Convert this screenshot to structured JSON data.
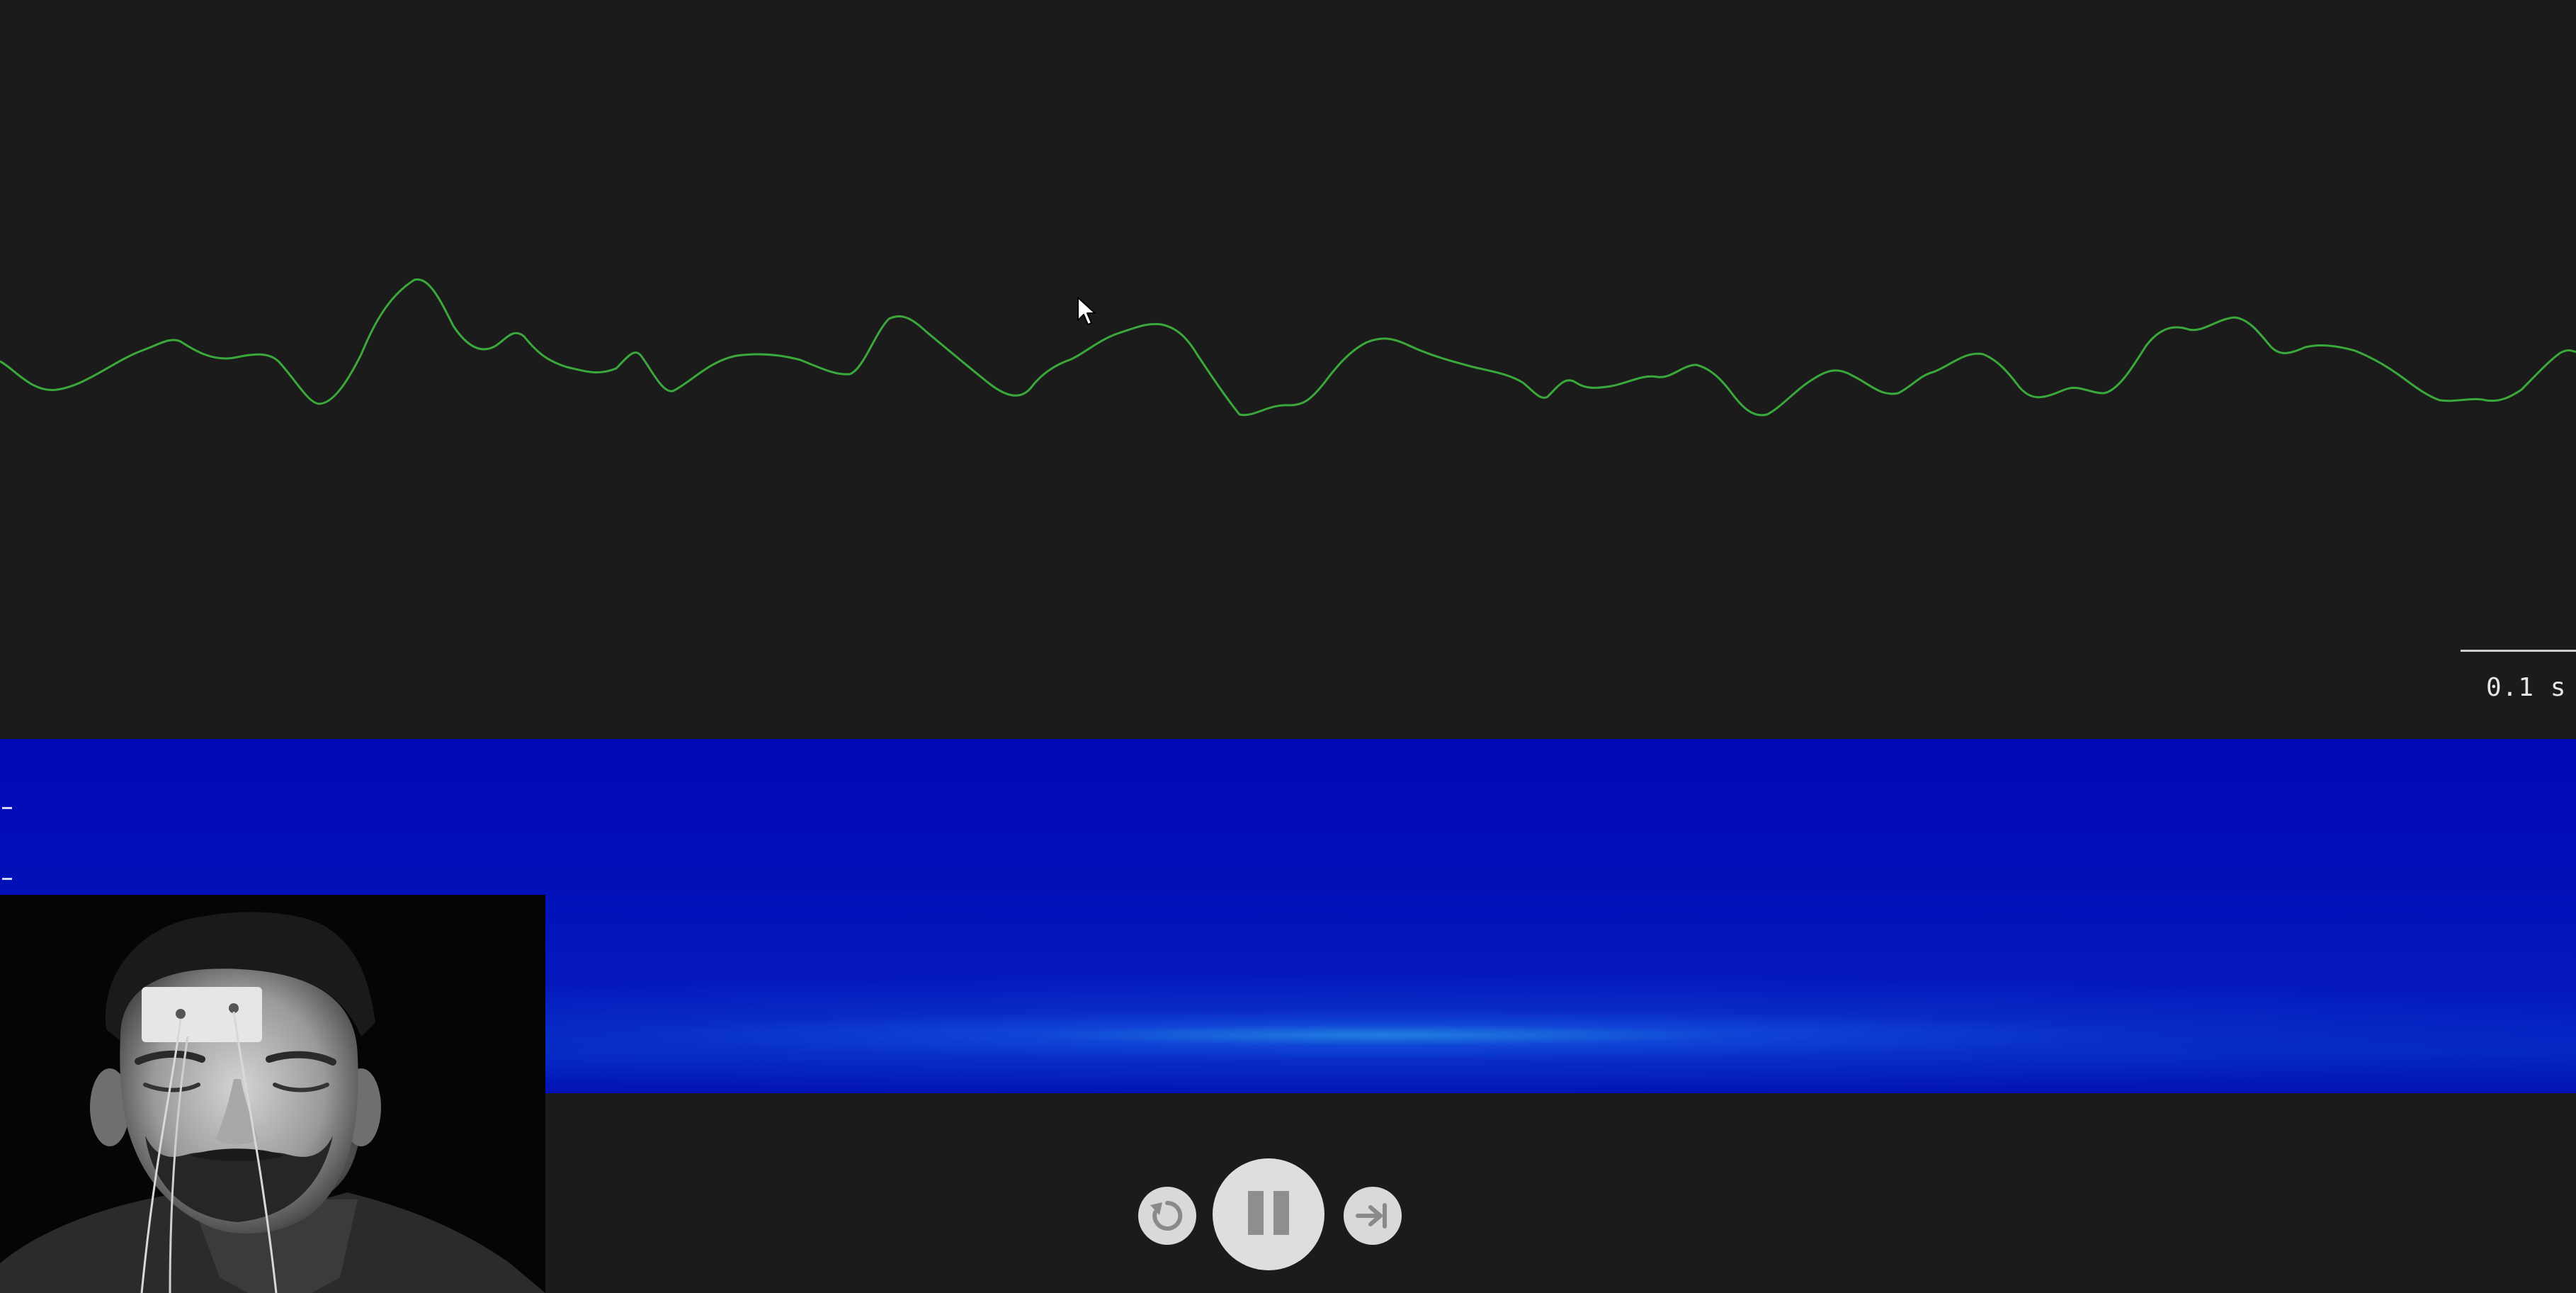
{
  "scale": {
    "label": "0.1 s"
  },
  "colors": {
    "background": "#1b1b1b",
    "waveform": "#3aa83a",
    "spectrogram_base": "#0208b6",
    "control_button": "#d9d9d9"
  },
  "controls": {
    "replay_icon": "replay-icon",
    "pause_icon": "pause-icon",
    "skip_icon": "skip-to-end-icon",
    "state": "playing"
  },
  "webcam": {
    "description_icon": "webcam-feed"
  }
}
